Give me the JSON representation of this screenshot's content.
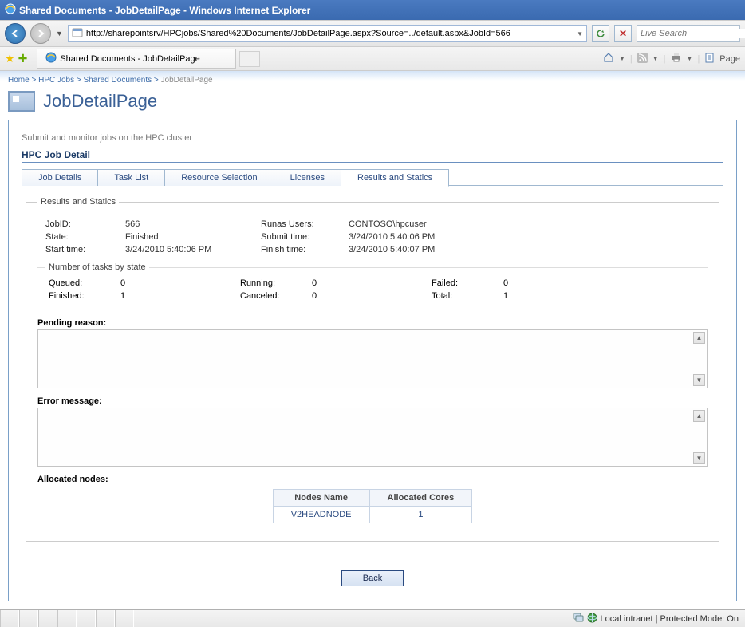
{
  "window": {
    "title": "Shared Documents - JobDetailPage - Windows Internet Explorer"
  },
  "address": {
    "url": "http://sharepointsrv/HPCjobs/Shared%20Documents/JobDetailPage.aspx?Source=../default.aspx&JobId=566"
  },
  "search": {
    "placeholder": "Live Search"
  },
  "tab": {
    "title": "Shared Documents - JobDetailPage"
  },
  "toolbar_right": {
    "page_label": "Page"
  },
  "breadcrumb": {
    "home": "Home",
    "hpc": "HPC Jobs",
    "shared": "Shared Documents",
    "current": "JobDetailPage"
  },
  "page": {
    "title": "JobDetailPage"
  },
  "panel": {
    "subtitle": "Submit and monitor jobs on the HPC cluster",
    "heading": "HPC Job Detail"
  },
  "tabs": {
    "job_details": "Job Details",
    "task_list": "Task List",
    "resource_selection": "Resource Selection",
    "licenses": "Licenses",
    "results": "Results and Statics"
  },
  "results": {
    "legend": "Results and Statics",
    "jobid_label": "JobID:",
    "jobid_value": "566",
    "runas_label": "Runas Users:",
    "runas_value": "CONTOSO\\hpcuser",
    "state_label": "State:",
    "state_value": "Finished",
    "submit_label": "Submit time:",
    "submit_value": "3/24/2010 5:40:06 PM",
    "start_label": "Start time:",
    "start_value": "3/24/2010 5:40:06 PM",
    "finish_label": "Finish time:",
    "finish_value": "3/24/2010 5:40:07 PM"
  },
  "tasks": {
    "legend": "Number of tasks by state",
    "queued_label": "Queued:",
    "queued_value": "0",
    "running_label": "Running:",
    "running_value": "0",
    "failed_label": "Failed:",
    "failed_value": "0",
    "finished_label": "Finished:",
    "finished_value": "1",
    "canceled_label": "Canceled:",
    "canceled_value": "0",
    "total_label": "Total:",
    "total_value": "1"
  },
  "pending": {
    "label": "Pending reason:"
  },
  "error": {
    "label": "Error message:"
  },
  "allocated": {
    "label": "Allocated nodes:",
    "col_name": "Nodes Name",
    "col_cores": "Allocated Cores",
    "row_name": "V2HEADNODE",
    "row_cores": "1"
  },
  "buttons": {
    "back": "Back"
  },
  "status": {
    "zone": "Local intranet | Protected Mode: On"
  }
}
